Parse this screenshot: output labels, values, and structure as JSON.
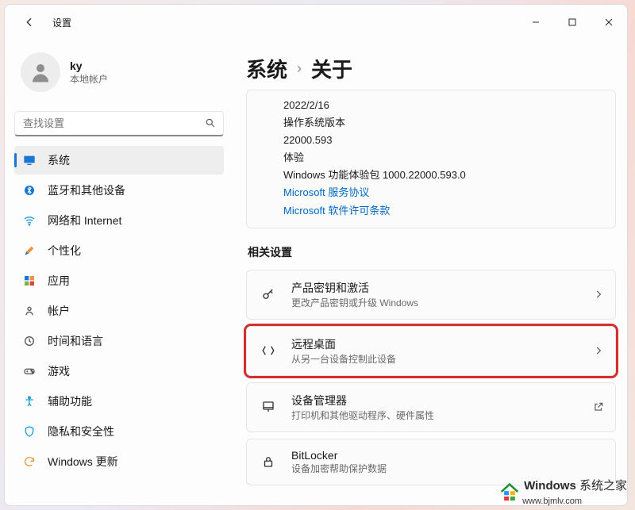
{
  "app_title": "设置",
  "profile": {
    "name": "ky",
    "subtitle": "本地帐户"
  },
  "search": {
    "placeholder": "查找设置"
  },
  "nav": {
    "items": [
      {
        "label": "系统"
      },
      {
        "label": "蓝牙和其他设备"
      },
      {
        "label": "网络和 Internet"
      },
      {
        "label": "个性化"
      },
      {
        "label": "应用"
      },
      {
        "label": "帐户"
      },
      {
        "label": "时间和语言"
      },
      {
        "label": "游戏"
      },
      {
        "label": "辅助功能"
      },
      {
        "label": "隐私和安全性"
      },
      {
        "label": "Windows 更新"
      }
    ]
  },
  "breadcrumb": {
    "root": "系统",
    "sep": "›",
    "leaf": "关于"
  },
  "spec": {
    "date": "2022/2/16",
    "os_label": "操作系统版本",
    "os_build": "22000.593",
    "exp_label": "体验",
    "exp_value": "Windows 功能体验包 1000.22000.593.0",
    "link1": "Microsoft 服务协议",
    "link2": "Microsoft 软件许可条款"
  },
  "related_title": "相关设置",
  "cards": [
    {
      "title": "产品密钥和激活",
      "sub": "更改产品密钥或升级 Windows",
      "tail": "chevron"
    },
    {
      "title": "远程桌面",
      "sub": "从另一台设备控制此设备",
      "tail": "chevron"
    },
    {
      "title": "设备管理器",
      "sub": "打印机和其他驱动程序、硬件属性",
      "tail": "open"
    },
    {
      "title": "BitLocker",
      "sub": "设备加密帮助保护数据",
      "tail": "open"
    }
  ],
  "watermark": {
    "brand": "Windows",
    "suffix": "系统之家",
    "url": "www.bjmlv.com"
  }
}
